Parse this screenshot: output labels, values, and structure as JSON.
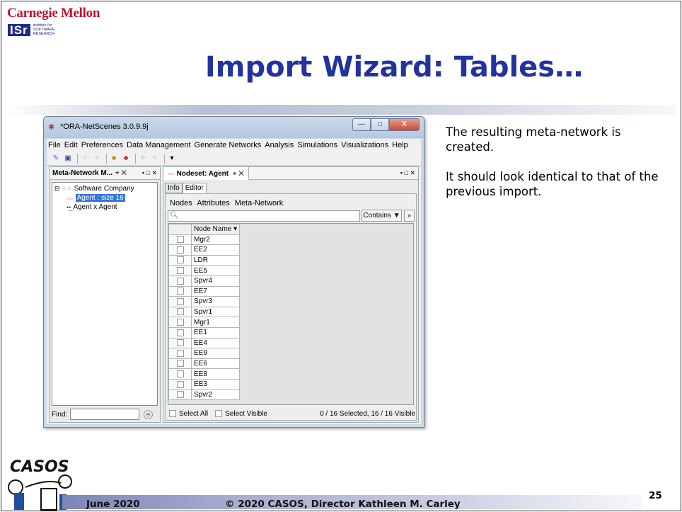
{
  "slide": {
    "logo_cmu": "Carnegie Mellon",
    "logo_isr": "ISr",
    "logo_isr_sub": "institute for SOFTWARE RESEARCH",
    "title": "Import Wizard: Tables…",
    "text1": "The resulting meta-network is created.",
    "text2": "It should look identical to that of the previous import.",
    "footer_date": "June 2020",
    "footer_copy": "© 2020 CASOS, Director Kathleen M. Carley",
    "page_number": "25",
    "casos_logo_text": "CASOS"
  },
  "app": {
    "window_title": "*ORA-NetScenes 3.0.9.9j",
    "window_buttons": {
      "minimize": "—",
      "maximize": "□",
      "close": "X"
    },
    "menu": [
      "File",
      "Edit",
      "Preferences",
      "Data Management",
      "Generate Networks",
      "Analysis",
      "Simulations",
      "Visualizations",
      "Help"
    ],
    "left_panel": {
      "tab_label": "Meta-Network M...",
      "tree": {
        "root": "Software Company",
        "nodeset": "Agent : size 16",
        "network": "Agent x Agent"
      },
      "find_label": "Find:"
    },
    "right_panel": {
      "tab_label": "Nodeset: Agent",
      "subtabs": [
        "Info",
        "Editor"
      ],
      "editor_menu": [
        "Nodes",
        "Attributes",
        "Meta-Network"
      ],
      "search_placeholder": "",
      "contains_label": "Contains",
      "column_header": "Node Name",
      "nodes": [
        "Mgr2",
        "EE2",
        "LDR",
        "EE5",
        "Spvr4",
        "EE7",
        "Spvr3",
        "Spvr1",
        "Mgr1",
        "EE1",
        "EE4",
        "EE9",
        "EE6",
        "EE8",
        "EE3",
        "Spvr2"
      ],
      "select_all": "Select All",
      "select_visible": "Select Visible",
      "status": "0 / 16 Selected, 16 / 16 Visible"
    }
  }
}
